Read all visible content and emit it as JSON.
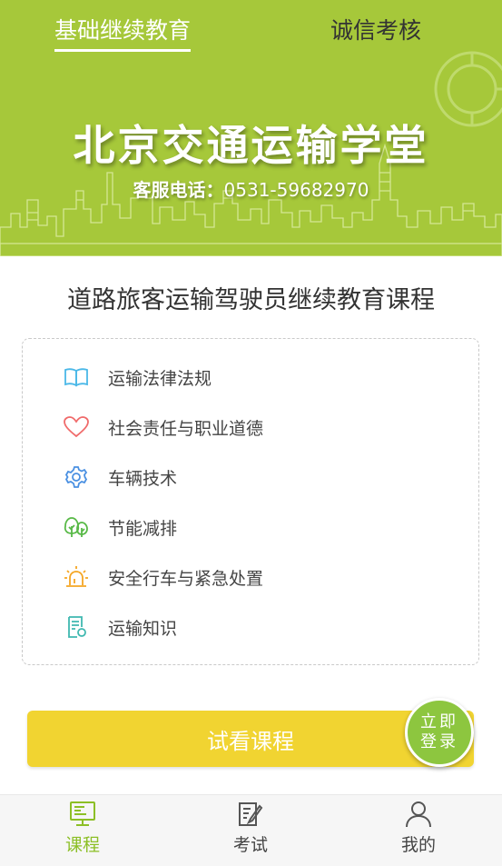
{
  "top_tabs": {
    "active": "基础继续教育",
    "other": "诚信考核"
  },
  "hero": {
    "title": "北京交通运输学堂",
    "phone_label": "客服电话：",
    "phone": "0531-59682970"
  },
  "course": {
    "title": "道路旅客运输驾驶员继续教育课程",
    "items": [
      {
        "label": "运输法律法规",
        "icon": "book-icon",
        "color": "#4ab8e8"
      },
      {
        "label": "社会责任与职业道德",
        "icon": "heart-icon",
        "color": "#f06a6a"
      },
      {
        "label": "车辆技术",
        "icon": "gear-icon",
        "color": "#4a90e2"
      },
      {
        "label": "节能减排",
        "icon": "tree-icon",
        "color": "#58b947"
      },
      {
        "label": "安全行车与紧急处置",
        "icon": "siren-icon",
        "color": "#f5a623"
      },
      {
        "label": "运输知识",
        "icon": "document-icon",
        "color": "#3fb8b0"
      }
    ]
  },
  "buttons": {
    "trial": "试看课程",
    "login_line1": "立即",
    "login_line2": "登录"
  },
  "bottom_nav": {
    "courses": "课程",
    "exam": "考试",
    "me": "我的"
  },
  "colors": {
    "brand_green": "#a6c83a",
    "accent_green": "#8cbf26",
    "button_yellow": "#f1d431"
  }
}
